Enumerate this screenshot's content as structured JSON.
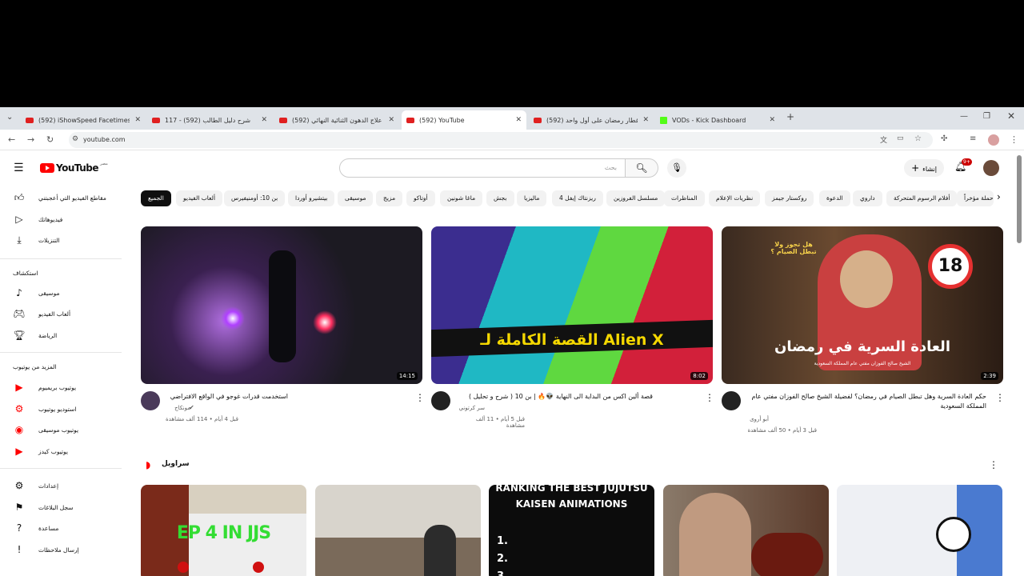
{
  "browser": {
    "tabs": [
      {
        "title": "(592) iShowSpeed Facetimes Eu"
      },
      {
        "title": "117 - شرح دليل الطالب (592)"
      },
      {
        "title": "(592) علاج الدهون الثنائية النهائي"
      },
      {
        "title": "(592) YouTube"
      },
      {
        "title": "(592) فطار رمضان على أول واحد"
      },
      {
        "title": "VODs - Kick Dashboard"
      }
    ],
    "new_tab": "+",
    "url": "youtube.com"
  },
  "header": {
    "logo_text": "YouTube",
    "logo_sub": "مصر",
    "search_placeholder": "بحث",
    "create_label": "إنشاء",
    "notif_count": "9+"
  },
  "sidebar": {
    "top_items": [
      {
        "label": "مقاطع الفيديو التي أعجبتني",
        "icon": "thumbs-up-icon"
      },
      {
        "label": "فيديوهاتك",
        "icon": "play-icon"
      },
      {
        "label": "التنزيلات",
        "icon": "download-icon"
      }
    ],
    "explore_title": "استكشاف",
    "explore_items": [
      {
        "label": "موسيقى",
        "icon": "music-icon"
      },
      {
        "label": "ألعاب الفيديو",
        "icon": "gamepad-icon"
      },
      {
        "label": "الرياضة",
        "icon": "trophy-icon"
      }
    ],
    "more_title": "المزيد من يوتيوب",
    "more_items": [
      {
        "label": "يوتيوب بريميوم"
      },
      {
        "label": "استوديو يوتيوب"
      },
      {
        "label": "يوتيوب موسيقى"
      },
      {
        "label": "يوتيوب كيدز"
      }
    ],
    "bottom_items": [
      {
        "label": "إعدادات",
        "icon": "gear-icon"
      },
      {
        "label": "سجل البلاغات",
        "icon": "flag-icon"
      },
      {
        "label": "مساعدة",
        "icon": "help-icon"
      },
      {
        "label": "إرسال ملاحظات",
        "icon": "feedback-icon"
      }
    ]
  },
  "chips": [
    "الجميع",
    "ألعاب الفيديو",
    "بن 10: أومنيفيرس",
    "بيتشيرو أوردا",
    "موسيقى",
    "مزيج",
    "أوتاكو",
    "ماغا شونين",
    "بجش",
    "ماليزيا",
    "ريزنتاك إيفل 4",
    "مسلسل الفروزين",
    "المناظرات",
    "نظريات الإعلام",
    "روكستار جيمز",
    "الدعوة",
    "داروي",
    "أفلام الرسوم المتحركة",
    "حملة مؤخراً"
  ],
  "videos": [
    {
      "title": "استخدمت قدرات غوجو في الواقع الافتراضي",
      "channel": "مونكاج",
      "meta": "قبل 4 أيام • 114 ألف مشاهدة",
      "duration": "14:15"
    },
    {
      "title": "قصة ألين اكس من البداية الى النهاية 👽🔥 | بن 10 ( شرح و تحليل )",
      "channel": "سر كرتوني",
      "meta": "قبل 5 أيام • 11 ألف مشاهدة",
      "duration": "8:02",
      "thumb_text": "القصة الكاملة لـ Alien X"
    },
    {
      "title": "حكم العادة السرية وهل تبطل الصيام في رمضان؟ لفضيلة الشيخ صالح الفوزان مفتي عام المملكة السعودية",
      "channel": "أبو أروى",
      "meta": "قبل 3 أيام • 50 ألف مشاهدة",
      "duration": "2:39",
      "thumb_text": "العادة السرية في رمضان",
      "thumb_sub": "الشيخ صالح الفوزان مفتي عام المملكة السعودية",
      "thumb_question": "هل تجوز ولا تبطل الصيام ؟",
      "thumb_badge": "18"
    }
  ],
  "shorts": {
    "title": "سراويل",
    "items": [
      {
        "text": "EP 4 IN JJS"
      },
      {
        "text": ""
      },
      {
        "text": "RANKING THE BEST JUJUTSU KAISEN ANIMATIONS",
        "list": [
          "1.",
          "2.",
          "3."
        ]
      },
      {
        "text": ""
      },
      {
        "text": ""
      }
    ]
  }
}
